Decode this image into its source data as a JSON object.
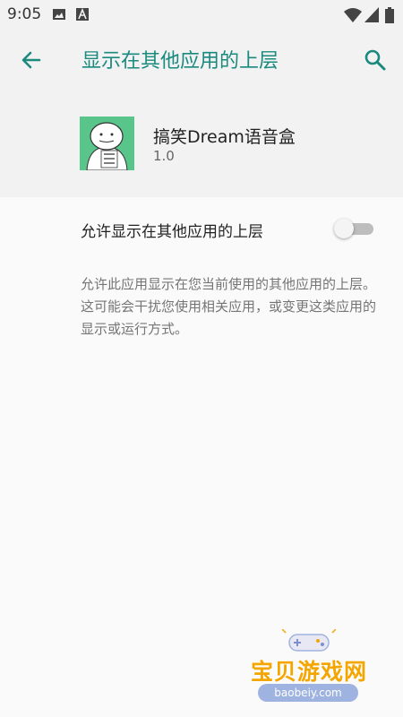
{
  "status_bar": {
    "time": "9:05",
    "icons": [
      "image-icon",
      "android-a-icon",
      "wifi-icon",
      "signal-icon",
      "battery-icon"
    ]
  },
  "toolbar": {
    "title": "显示在其他应用的上层",
    "back_icon": "arrow-back-icon",
    "search_icon": "search-icon"
  },
  "app": {
    "name": "搞笑Dream语音盒",
    "version": "1.0",
    "icon_colors": {
      "background": "#5ac58a"
    }
  },
  "permission": {
    "label": "允许显示在其他应用的上层",
    "toggle_on": false,
    "description": "允许此应用显示在您当前使用的其他应用的上层。这可能会干扰您使用相关应用，或变更这类应用的显示或运行方式。"
  },
  "watermark": {
    "text": "宝贝游戏网",
    "url": "baobeiy.com"
  },
  "colors": {
    "accent": "#1a8a7e",
    "background": "#fafafa",
    "header_background": "#f2f2f2"
  }
}
